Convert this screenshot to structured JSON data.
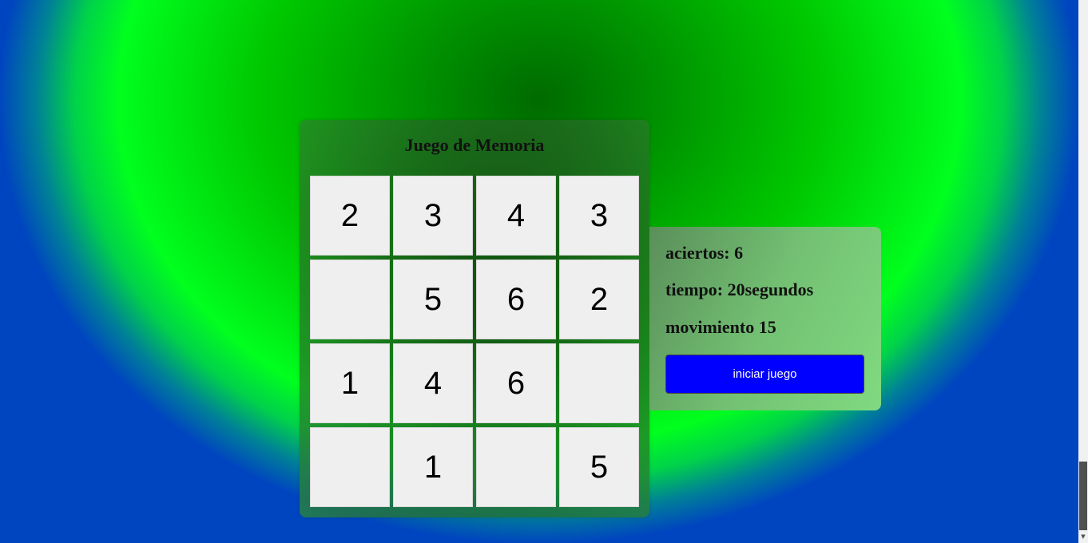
{
  "game": {
    "title": "Juego de Memoria",
    "cards": [
      "2",
      "3",
      "4",
      "3",
      "",
      "5",
      "6",
      "2",
      "1",
      "4",
      "6",
      "",
      "",
      "1",
      "",
      "5"
    ]
  },
  "stats": {
    "aciertos": "aciertos: 6",
    "tiempo": "tiempo: 20segundos",
    "movimientos": "movimiento 15"
  },
  "controls": {
    "start_label": "iniciar juego"
  },
  "colors": {
    "button_bg": "#0000ff",
    "card_bg": "#efefef",
    "background_center": "#006a00",
    "background_ring": "#00ff1e",
    "background_edge": "#0045c0"
  }
}
